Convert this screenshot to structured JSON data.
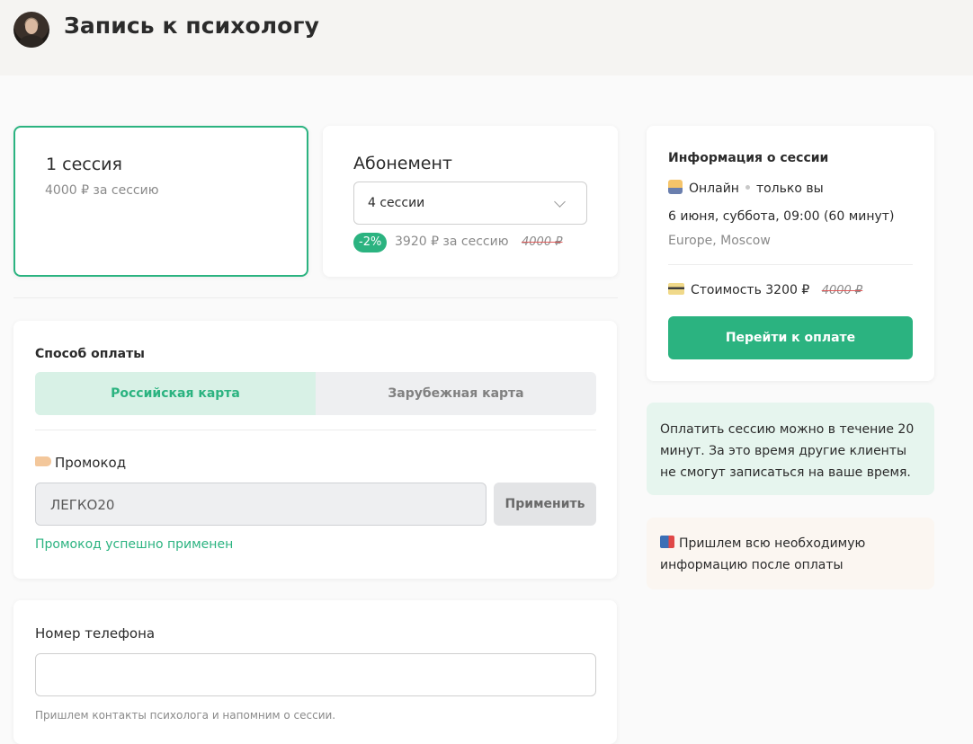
{
  "header": {
    "title": "Запись к психологу",
    "avatar_alt": "psychologist-photo"
  },
  "plans": {
    "single": {
      "title": "1 сессия",
      "price_text": "4000 ₽ за сессию",
      "selected": true
    },
    "subscription": {
      "title": "Абонемент",
      "select_value": "4 сессии",
      "discount_badge": "-2%",
      "price_text": "3920 ₽ за сессию",
      "old_price": "4000 ₽"
    }
  },
  "payment": {
    "section_title": "Способ оплаты",
    "options": [
      {
        "label": "Российская карта",
        "active": true
      },
      {
        "label": "Зарубежная карта",
        "active": false
      }
    ],
    "promo": {
      "label": "Промокод",
      "value": "ЛЕГКО20",
      "apply_label": "Применить",
      "success_text": "Промокод успешно применен"
    }
  },
  "phone": {
    "label": "Номер телефона",
    "value": "",
    "hint": "Пришлем контакты психолога и напомним о сессии."
  },
  "session_info": {
    "title": "Информация о сессии",
    "format": "Онлайн",
    "participants": "только вы",
    "datetime": "6 июня, суббота, 09:00 (60 минут)",
    "timezone": "Europe, Moscow",
    "cost_label": "Стоимость 3200 ₽",
    "cost_old": "4000 ₽",
    "pay_button": "Перейти к оплате"
  },
  "notes": {
    "time_limit": "Оплатить сессию можно в течение 20 минут. За это время другие клиенты не смогут записаться на ваше время.",
    "after_payment": "Пришлем всю необходимую информацию после оплаты"
  },
  "colors": {
    "accent": "#2bb380",
    "accent_light": "#d8f1e6",
    "strike": "#e05a5a"
  }
}
